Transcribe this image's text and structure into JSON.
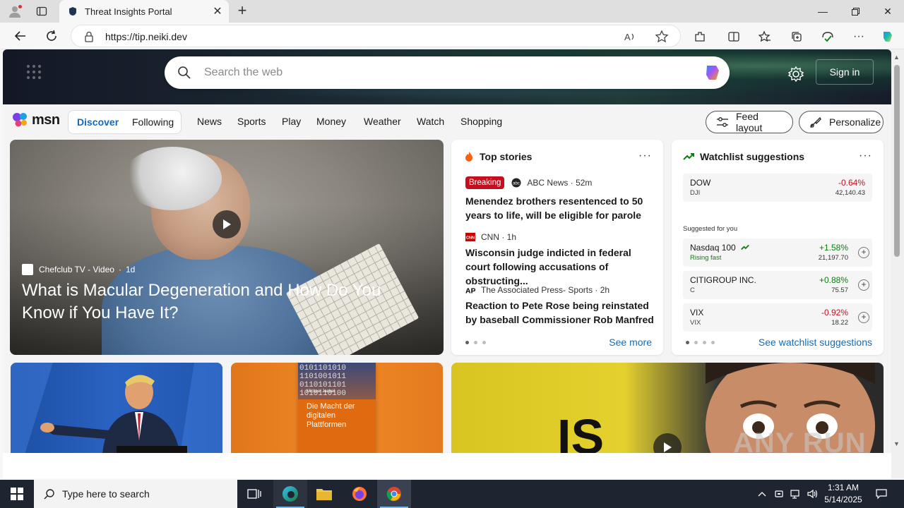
{
  "browser": {
    "tab_title": "Threat Insights Portal",
    "url": "https://tip.neiki.dev"
  },
  "page": {
    "search_placeholder": "Search the web",
    "signin_label": "Sign in",
    "logo_text": "msn",
    "nav": {
      "discover": "Discover",
      "following": "Following",
      "links": [
        "News",
        "Sports",
        "Play",
        "Money",
        "Weather",
        "Watch",
        "Shopping"
      ],
      "feed_layout": "Feed layout",
      "personalize": "Personalize"
    },
    "hero": {
      "source": "Chefclub TV - Video",
      "age": "1d",
      "title": "What is Macular Degeneration and How Do You Know if You Have It?"
    },
    "top_stories": {
      "title": "Top stories",
      "breaking_label": "Breaking",
      "stories": [
        {
          "source": "ABC News · 52m",
          "headline": "Menendez brothers resentenced to 50 years to life, will be eligible for parole"
        },
        {
          "source": "CNN · 1h",
          "headline": "Wisconsin judge indicted in federal court following accusations of obstructing..."
        },
        {
          "source": "The Associated Press- Sports · 2h",
          "headline": "Reaction to Pete Rose being reinstated by baseball Commissioner Rob Manfred"
        }
      ],
      "see_more": "See more"
    },
    "watchlist": {
      "title": "Watchlist suggestions",
      "suggested_label": "Suggested for you",
      "see_link": "See watchlist suggestions",
      "items": [
        {
          "name": "DOW",
          "sub": "DJI",
          "change": "-0.64%",
          "value": "42,140.43"
        },
        {
          "name": "Nasdaq 100",
          "sub": "Rising fast",
          "change": "+1.58%",
          "value": "21,197.70"
        },
        {
          "name": "CITIGROUP INC.",
          "sub": "C",
          "change": "+0.88%",
          "value": "75.57"
        },
        {
          "name": "VIX",
          "sub": "VIX",
          "change": "-0.92%",
          "value": "18.22"
        }
      ]
    },
    "book_tile": {
      "author": "Michael Jaekel",
      "title_line1": "Die Macht der",
      "title_line2": "digitalen Plattformen"
    },
    "tile3_text": "IS"
  },
  "watermark": "ANY RUN",
  "taskbar": {
    "search_placeholder": "Type here to search",
    "time": "1:31 AM",
    "date": "5/14/2025"
  },
  "colors": {
    "accent": "#0f6cbd",
    "breaking": "#c50f1f",
    "positive": "#107c10",
    "negative": "#c50f1f",
    "taskbar": "#1f2530"
  }
}
